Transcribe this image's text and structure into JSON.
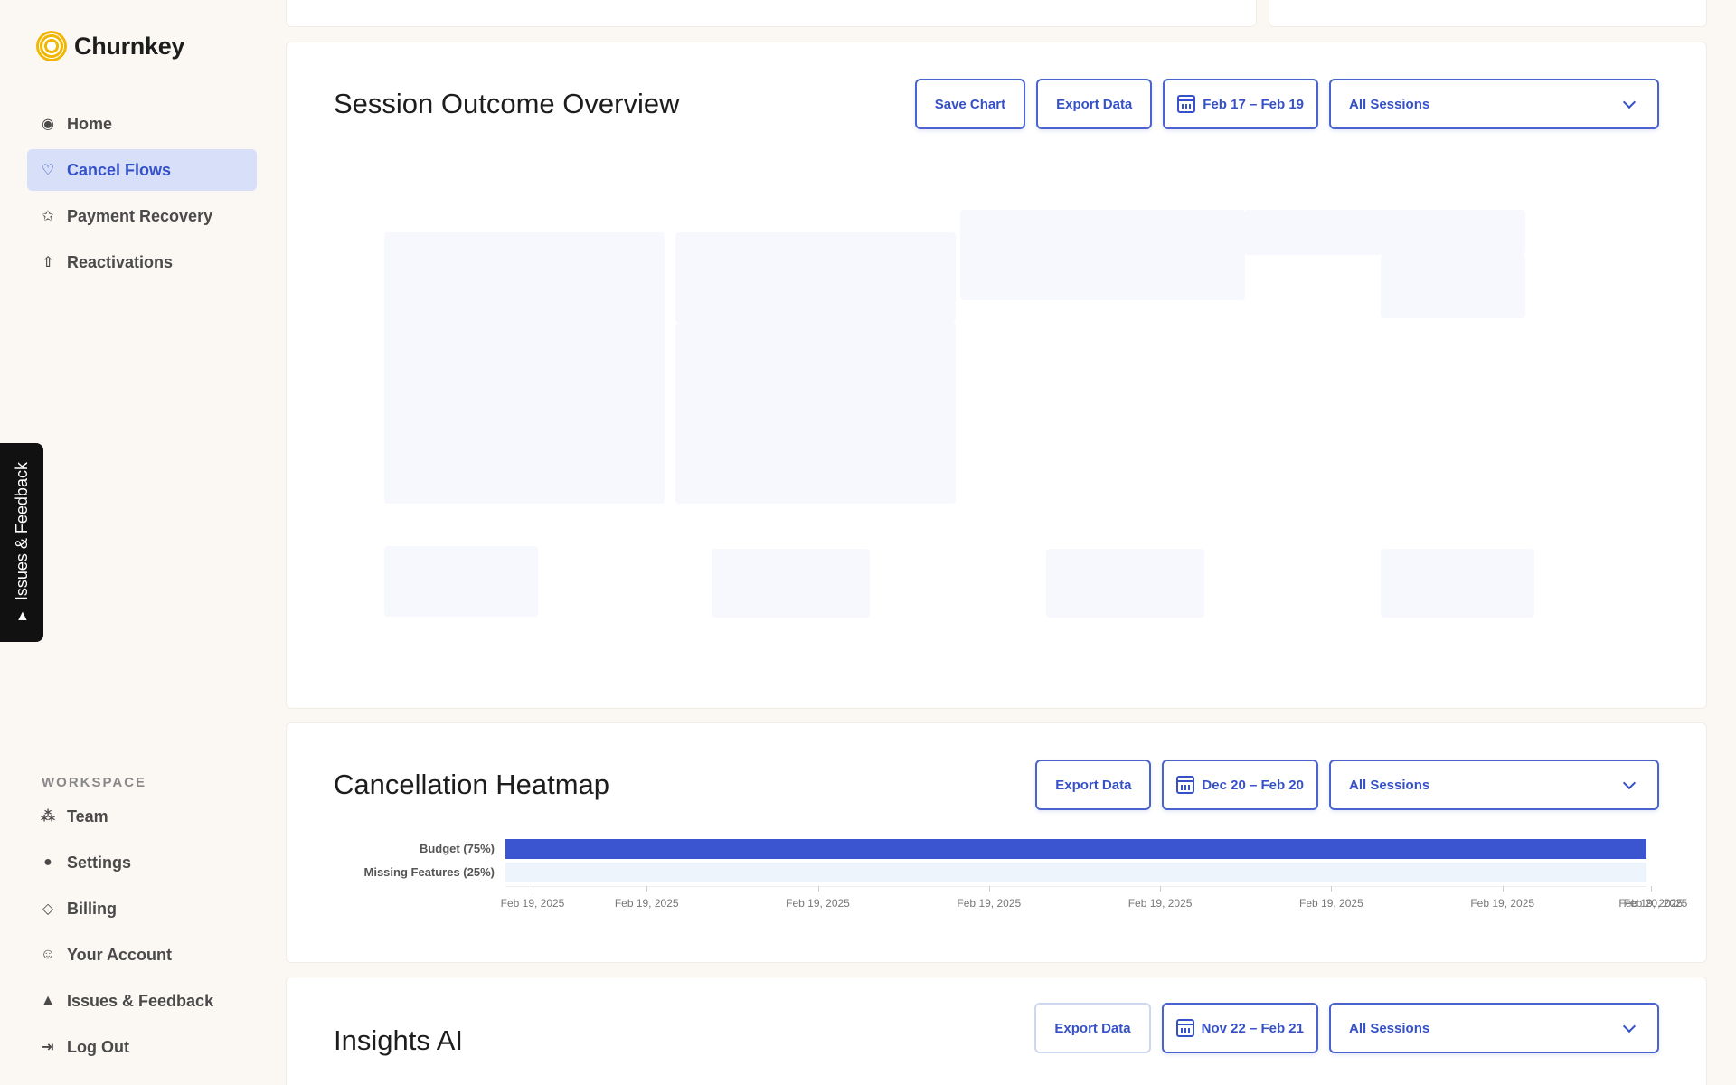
{
  "app": {
    "name": "Churnkey"
  },
  "sidebar": {
    "items": [
      {
        "label": "Home",
        "icon": "eye-icon"
      },
      {
        "label": "Cancel Flows",
        "icon": "heart-icon",
        "active": true
      },
      {
        "label": "Payment Recovery",
        "icon": "star-icon"
      },
      {
        "label": "Reactivations",
        "icon": "arrow-up-icon"
      }
    ],
    "workspace_label": "WORKSPACE",
    "workspace_items": [
      {
        "label": "Team",
        "icon": "team-icon"
      },
      {
        "label": "Settings",
        "icon": "settings-icon"
      },
      {
        "label": "Billing",
        "icon": "diamond-icon"
      },
      {
        "label": "Your Account",
        "icon": "user-circle-icon"
      },
      {
        "label": "Issues & Feedback",
        "icon": "feedback-icon"
      },
      {
        "label": "Log Out",
        "icon": "logout-icon"
      }
    ]
  },
  "feedback_tab": {
    "label": "Issues & Feedback"
  },
  "session_overview": {
    "title": "Session Outcome Overview",
    "save_label": "Save Chart",
    "export_label": "Export Data",
    "date_range": "Feb 17  –  Feb 19",
    "filter": "All Sessions"
  },
  "heatmap": {
    "title": "Cancellation Heatmap",
    "export_label": "Export Data",
    "date_range": "Dec 20 – Feb 20",
    "filter": "All Sessions"
  },
  "insights": {
    "title": "Insights AI",
    "export_label": "Export Data",
    "date_range": "Nov 22 – Feb 21",
    "filter": "All Sessions"
  },
  "colors": {
    "accent": "#3651c8",
    "active_bg": "#d7e0f8",
    "bar_primary": "#3a55cf",
    "bar_secondary": "#eef4fc"
  },
  "chart_data": {
    "type": "bar",
    "categories": [
      "Budget (75%)",
      "Missing Features (25%)"
    ],
    "values": [
      75,
      25
    ],
    "x_ticks": [
      "Feb 19, 2025",
      "Feb 19, 2025",
      "Feb 19, 2025",
      "Feb 19, 2025",
      "Feb 19, 2025",
      "Feb 19, 2025",
      "Feb 19, 2025",
      "Feb 19, 2025",
      "Feb 20, 2025"
    ],
    "title": "",
    "xlabel": "",
    "ylabel": ""
  }
}
